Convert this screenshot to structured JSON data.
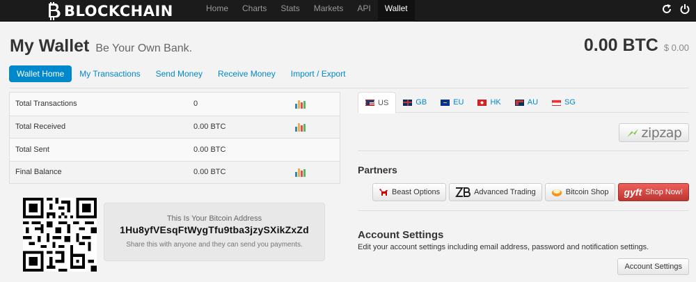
{
  "nav": {
    "brand": "BLOCKCHAIN",
    "links": [
      "Home",
      "Charts",
      "Stats",
      "Markets",
      "API",
      "Wallet"
    ],
    "active": "Wallet"
  },
  "header": {
    "title": "My Wallet",
    "subtitle": "Be Your Own Bank.",
    "balance_btc": "0.00 BTC",
    "balance_usd": "$ 0.00"
  },
  "tabs": [
    "Wallet Home",
    "My Transactions",
    "Send Money",
    "Receive Money",
    "Import / Export"
  ],
  "stats": [
    {
      "label": "Total Transactions",
      "value": "0",
      "chart": true
    },
    {
      "label": "Total Received",
      "value": "0.00 BTC",
      "chart": true
    },
    {
      "label": "Total Sent",
      "value": "0.00 BTC",
      "chart": false
    },
    {
      "label": "Final Balance",
      "value": "0.00 BTC",
      "chart": true
    }
  ],
  "address": {
    "heading": "This Is Your Bitcoin Address",
    "value": "1Hu8yfVEsqFtWygTfu9tba3jzySXikZxZd",
    "note": "Share this with anyone and they can send you payments."
  },
  "countries": [
    {
      "code": "US",
      "flag": "us-flag"
    },
    {
      "code": "GB",
      "flag": "gb-flag"
    },
    {
      "code": "EU",
      "flag": "eu-flag"
    },
    {
      "code": "HK",
      "flag": "hk-flag"
    },
    {
      "code": "AU",
      "flag": "au-flag"
    },
    {
      "code": "SG",
      "flag": "sg-flag"
    }
  ],
  "zipzap": "zipzap",
  "partners": {
    "heading": "Partners",
    "items": [
      "Beast Options",
      "Advanced Trading",
      "Bitcoin Shop",
      "Shop Now!"
    ],
    "gyft_logo": "gyft"
  },
  "account": {
    "heading": "Account Settings",
    "description": "Edit your account settings including email address, password and notification settings.",
    "button": "Account Settings"
  },
  "colors": {
    "accent": "#0088cc",
    "navbar": "#1b1b1b",
    "gyft": "#da4f49"
  }
}
